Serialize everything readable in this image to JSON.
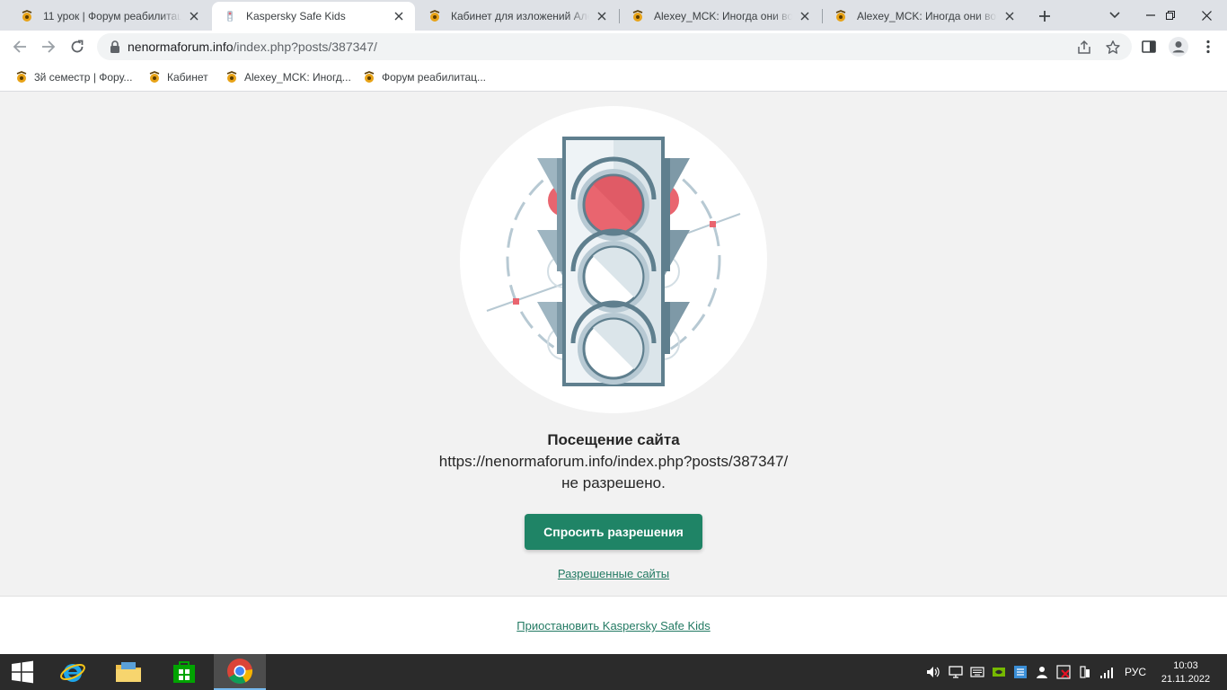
{
  "tabs": [
    {
      "title": "11 урок | Форум реабилитации",
      "active": false
    },
    {
      "title": "Kaspersky Safe Kids",
      "active": true
    },
    {
      "title": "Кабинет для изложений Алексей",
      "active": false
    },
    {
      "title": "Alexey_MCK: Иногда они возвращаются",
      "active": false
    },
    {
      "title": "Alexey_MCK: Иногда они возвращаются",
      "active": false
    }
  ],
  "address": {
    "host": "nenormaforum.info",
    "path": "/index.php?posts/387347/"
  },
  "bookmarks": [
    {
      "label": "3й семестр | Фору..."
    },
    {
      "label": "Кабинет"
    },
    {
      "label": "Alexey_MCK: Иногд..."
    },
    {
      "label": "Форум реабилитац..."
    }
  ],
  "block_page": {
    "title": "Посещение сайта",
    "url": "https://nenormaforum.info/index.php?posts/387347/",
    "status": "не разрешено.",
    "ask_button": "Спросить разрешения",
    "allowed_sites_link": "Разрешенные сайты",
    "pause_link": "Приостановить Kaspersky Safe Kids"
  },
  "taskbar": {
    "language": "РУС",
    "time": "10:03",
    "date": "21.11.2022"
  },
  "colors": {
    "accent": "#1f8466",
    "link": "#237a63",
    "signal_red": "#e9656f",
    "light_frame": "#5f7f8e"
  }
}
